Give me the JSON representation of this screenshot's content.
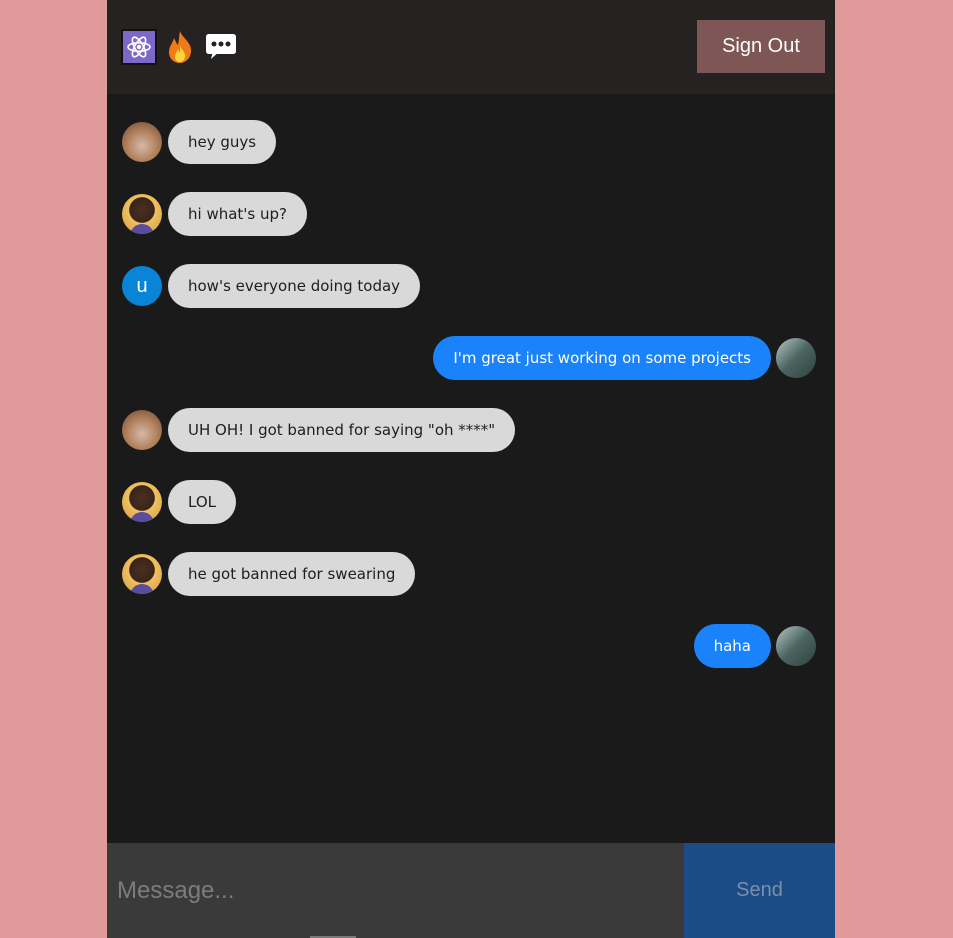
{
  "header": {
    "icons": [
      "atom-icon",
      "fire-icon",
      "speech-bubble-icon"
    ],
    "sign_out_label": "Sign Out"
  },
  "messages": [
    {
      "direction": "received",
      "avatar": "hamster",
      "text": "hey guys"
    },
    {
      "direction": "received",
      "avatar": "man",
      "text": "hi what's up?"
    },
    {
      "direction": "received",
      "avatar": "letter",
      "avatar_letter": "u",
      "text": "how's everyone doing today"
    },
    {
      "direction": "sent",
      "avatar": "tree",
      "text": "I'm great just working on some projects"
    },
    {
      "direction": "received",
      "avatar": "hamster",
      "text": "UH OH! I got banned for saying \"oh ****\""
    },
    {
      "direction": "received",
      "avatar": "man",
      "text": "LOL"
    },
    {
      "direction": "received",
      "avatar": "man",
      "text": "he got banned for swearing"
    },
    {
      "direction": "sent",
      "avatar": "tree",
      "text": "haha"
    }
  ],
  "composer": {
    "placeholder": "Message...",
    "value": "",
    "send_label": "Send"
  },
  "colors": {
    "page_bg": "#e09a9a",
    "app_bg": "#1b1a1b",
    "header_bg": "#262222",
    "sign_out_bg": "#7e5656",
    "received_bubble": "#d9d9d9",
    "sent_bubble": "#1a82fb",
    "send_button": "#1b4c88"
  }
}
